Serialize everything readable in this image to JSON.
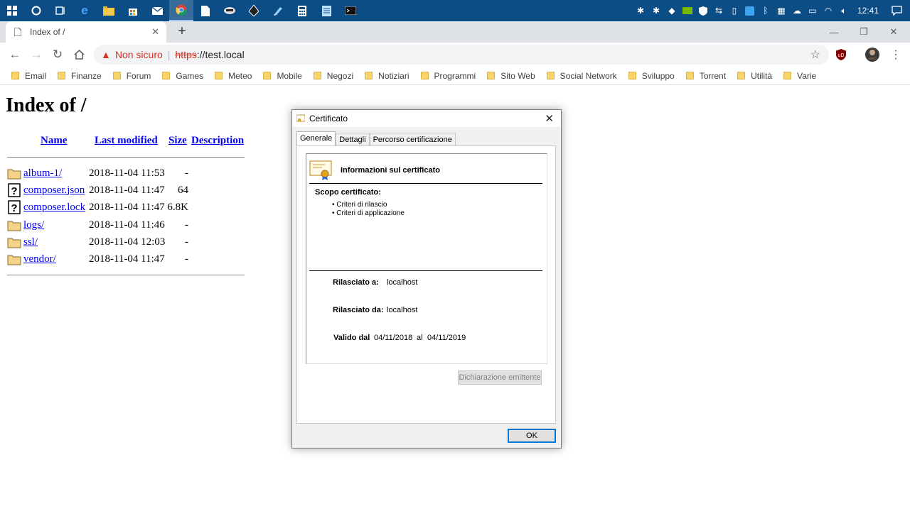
{
  "taskbar": {
    "time": "12:41"
  },
  "browser": {
    "tab_title": "Index of /",
    "security_label": "Non sicuro",
    "url_scheme": "https",
    "url_rest": "://test.local"
  },
  "bookmarks": [
    "Email",
    "Finanze",
    "Forum",
    "Games",
    "Meteo",
    "Mobile",
    "Negozi",
    "Notiziari",
    "Programmi",
    "Sito Web",
    "Social Network",
    "Sviluppo",
    "Torrent",
    "Utilità",
    "Varie"
  ],
  "listing": {
    "heading": "Index of /",
    "columns": {
      "name": "Name",
      "last_modified": "Last modified",
      "size": "Size",
      "description": "Description"
    },
    "rows": [
      {
        "type": "folder",
        "name": "album-1/",
        "date": "2018-11-04 11:53",
        "size": "-"
      },
      {
        "type": "file",
        "name": "composer.json",
        "date": "2018-11-04 11:47",
        "size": "64"
      },
      {
        "type": "file",
        "name": "composer.lock",
        "date": "2018-11-04 11:47",
        "size": "6.8K"
      },
      {
        "type": "folder",
        "name": "logs/",
        "date": "2018-11-04 11:46",
        "size": "-"
      },
      {
        "type": "folder",
        "name": "ssl/",
        "date": "2018-11-04 12:03",
        "size": "-"
      },
      {
        "type": "folder",
        "name": "vendor/",
        "date": "2018-11-04 11:47",
        "size": "-"
      }
    ]
  },
  "dialog": {
    "title": "Certificato",
    "tabs": [
      "Generale",
      "Dettagli",
      "Percorso certificazione"
    ],
    "active_tab": "Generale",
    "header": "Informazioni sul certificato",
    "scope_label": "Scopo certificato:",
    "scope_items": [
      "• Criteri di rilascio",
      "• Criteri di applicazione"
    ],
    "issued_to_label": "Rilasciato a:",
    "issued_to": "localhost",
    "issued_by_label": "Rilasciato da:",
    "issued_by": "localhost",
    "valid_from_label": "Valido dal",
    "valid_from": "04/11/2018",
    "valid_to_label": "al",
    "valid_to": "04/11/2019",
    "issuer_statement_button": "Dichiarazione emittente",
    "ok_button": "OK"
  }
}
